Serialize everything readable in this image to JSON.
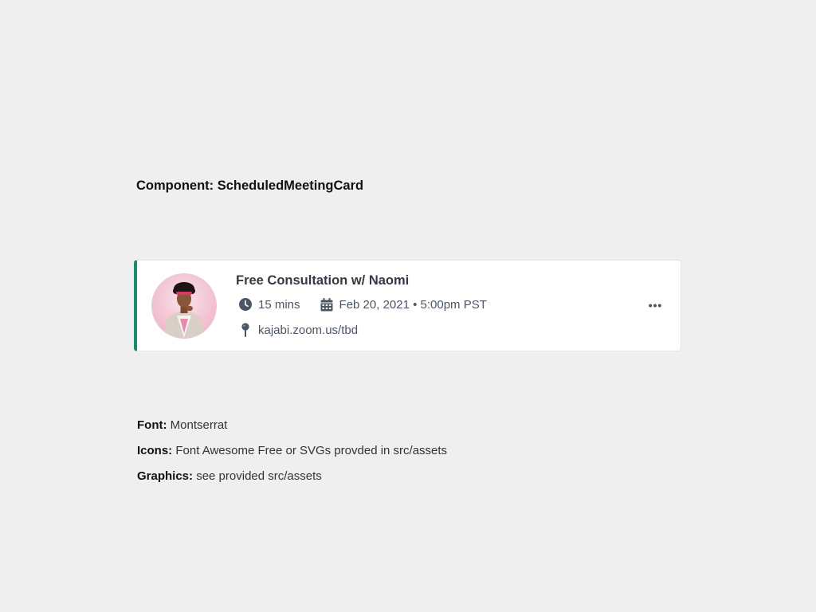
{
  "component_title": "Component: ScheduledMeetingCard",
  "card": {
    "accent_color": "#1c8a6e",
    "avatar_icon": "user-avatar-photo",
    "title": "Free Consultation w/ Naomi",
    "duration_icon": "clock-icon",
    "duration": "15 mins",
    "date_icon": "calendar-icon",
    "datetime": "Feb 20, 2021 • 5:00pm PST",
    "location_icon": "map-pin-icon",
    "location": "kajabi.zoom.us/tbd",
    "menu_icon": "ellipsis-horizontal-icon"
  },
  "notes": [
    {
      "label": "Font:",
      "value": " Montserrat"
    },
    {
      "label": "Icons:",
      "value": " Font Awesome Free or SVGs provded in src/assets"
    },
    {
      "label": "Graphics:",
      "value": " see provided src/assets"
    }
  ]
}
